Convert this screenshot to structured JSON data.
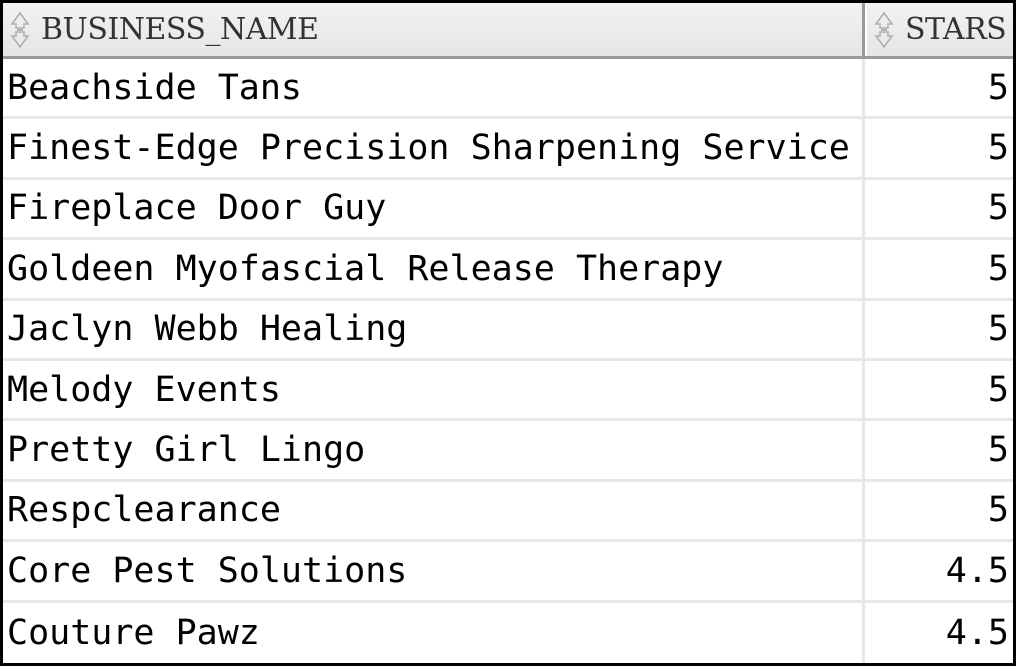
{
  "table": {
    "columns": [
      "BUSINESS_NAME",
      "STARS"
    ],
    "rows": [
      {
        "business_name": "Beachside Tans",
        "stars": "5"
      },
      {
        "business_name": "Finest-Edge Precision Sharpening Service",
        "stars": "5"
      },
      {
        "business_name": "Fireplace Door Guy",
        "stars": "5"
      },
      {
        "business_name": "Goldeen Myofascial Release Therapy",
        "stars": "5"
      },
      {
        "business_name": "Jaclyn Webb Healing",
        "stars": "5"
      },
      {
        "business_name": "Melody Events",
        "stars": "5"
      },
      {
        "business_name": "Pretty Girl Lingo",
        "stars": "5"
      },
      {
        "business_name": "Respclearance",
        "stars": "5"
      },
      {
        "business_name": "Core Pest Solutions",
        "stars": "4.5"
      },
      {
        "business_name": "Couture Pawz",
        "stars": "4.5"
      }
    ]
  },
  "icons": {
    "sort": "sort-updown-icon"
  }
}
